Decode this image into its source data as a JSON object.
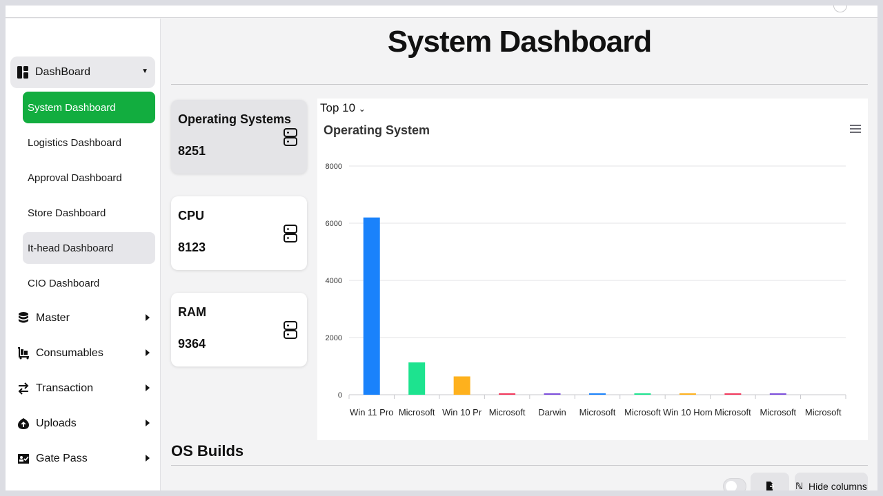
{
  "sidebar": {
    "group": {
      "label": "DashBoard",
      "icon": "dashboard-icon"
    },
    "sub_items": [
      {
        "label": "System Dashboard",
        "state": "active"
      },
      {
        "label": "Logistics Dashboard",
        "state": ""
      },
      {
        "label": "Approval Dashboard",
        "state": ""
      },
      {
        "label": "Store Dashboard",
        "state": ""
      },
      {
        "label": "It-head Dashboard",
        "state": "hover"
      },
      {
        "label": "CIO Dashboard",
        "state": ""
      }
    ],
    "menus": [
      {
        "label": "Master",
        "icon": "database-icon"
      },
      {
        "label": "Consumables",
        "icon": "cart-icon"
      },
      {
        "label": "Transaction",
        "icon": "swap-arrows-icon"
      },
      {
        "label": "Uploads",
        "icon": "upload-icon"
      },
      {
        "label": "Gate Pass",
        "icon": "gate-pass-icon"
      }
    ]
  },
  "page": {
    "title": "System Dashboard"
  },
  "cards": [
    {
      "label": "Operating Systems",
      "value": "8251",
      "icon": "server-icon",
      "selected": true
    },
    {
      "label": "CPU",
      "value": "8123",
      "icon": "server-icon",
      "selected": false
    },
    {
      "label": "RAM",
      "value": "9364",
      "icon": "server-icon",
      "selected": false
    }
  ],
  "chart_panel": {
    "top_select": "Top 10",
    "menu_icon": "hamburger-menu-icon"
  },
  "chart_data": {
    "type": "bar",
    "title": "Operating System",
    "xlabel": "",
    "ylabel": "",
    "categories": [
      "Win 11 Pro",
      "Microsoft",
      "Win 10 Pr",
      "Microsoft",
      "Darwin",
      "Microsoft",
      "Microsoft",
      "Win 10 Hom",
      "Microsoft",
      "Microsoft",
      "Microsoft"
    ],
    "values": [
      6200,
      1130,
      640,
      50,
      40,
      40,
      40,
      40,
      40,
      40,
      0
    ],
    "colors": [
      "#1a82fb",
      "#1de38f",
      "#feb11d",
      "#f2385c",
      "#7c4ddb",
      "#1a82fb",
      "#1de38f",
      "#feb11d",
      "#f2385c",
      "#7c4ddb",
      "#1a82fb"
    ],
    "yticks": [
      0,
      2000,
      4000,
      6000,
      8000
    ],
    "ylim": [
      0,
      8000
    ],
    "grid": true
  },
  "section": {
    "title": "OS Builds"
  },
  "toolbar": {
    "hide_columns_label": "Hide columns"
  }
}
